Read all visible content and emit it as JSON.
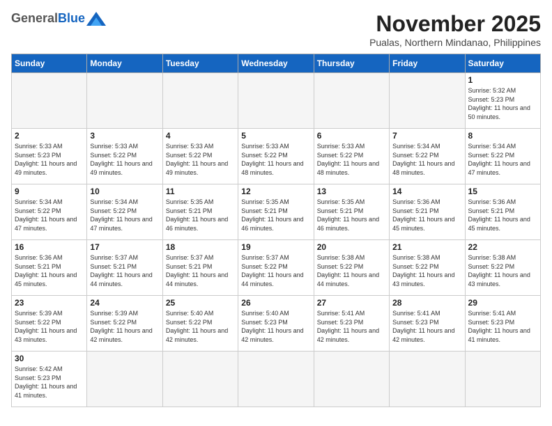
{
  "header": {
    "logo_general": "General",
    "logo_blue": "Blue",
    "month_title": "November 2025",
    "location": "Pualas, Northern Mindanao, Philippines"
  },
  "weekdays": [
    "Sunday",
    "Monday",
    "Tuesday",
    "Wednesday",
    "Thursday",
    "Friday",
    "Saturday"
  ],
  "weeks": [
    [
      {
        "day": "",
        "empty": true
      },
      {
        "day": "",
        "empty": true
      },
      {
        "day": "",
        "empty": true
      },
      {
        "day": "",
        "empty": true
      },
      {
        "day": "",
        "empty": true
      },
      {
        "day": "",
        "empty": true
      },
      {
        "day": "1",
        "sunrise": "5:32 AM",
        "sunset": "5:23 PM",
        "daylight": "11 hours and 50 minutes."
      }
    ],
    [
      {
        "day": "2",
        "sunrise": "5:33 AM",
        "sunset": "5:23 PM",
        "daylight": "11 hours and 49 minutes."
      },
      {
        "day": "3",
        "sunrise": "5:33 AM",
        "sunset": "5:22 PM",
        "daylight": "11 hours and 49 minutes."
      },
      {
        "day": "4",
        "sunrise": "5:33 AM",
        "sunset": "5:22 PM",
        "daylight": "11 hours and 49 minutes."
      },
      {
        "day": "5",
        "sunrise": "5:33 AM",
        "sunset": "5:22 PM",
        "daylight": "11 hours and 48 minutes."
      },
      {
        "day": "6",
        "sunrise": "5:33 AM",
        "sunset": "5:22 PM",
        "daylight": "11 hours and 48 minutes."
      },
      {
        "day": "7",
        "sunrise": "5:34 AM",
        "sunset": "5:22 PM",
        "daylight": "11 hours and 48 minutes."
      },
      {
        "day": "8",
        "sunrise": "5:34 AM",
        "sunset": "5:22 PM",
        "daylight": "11 hours and 47 minutes."
      }
    ],
    [
      {
        "day": "9",
        "sunrise": "5:34 AM",
        "sunset": "5:22 PM",
        "daylight": "11 hours and 47 minutes."
      },
      {
        "day": "10",
        "sunrise": "5:34 AM",
        "sunset": "5:22 PM",
        "daylight": "11 hours and 47 minutes."
      },
      {
        "day": "11",
        "sunrise": "5:35 AM",
        "sunset": "5:21 PM",
        "daylight": "11 hours and 46 minutes."
      },
      {
        "day": "12",
        "sunrise": "5:35 AM",
        "sunset": "5:21 PM",
        "daylight": "11 hours and 46 minutes."
      },
      {
        "day": "13",
        "sunrise": "5:35 AM",
        "sunset": "5:21 PM",
        "daylight": "11 hours and 46 minutes."
      },
      {
        "day": "14",
        "sunrise": "5:36 AM",
        "sunset": "5:21 PM",
        "daylight": "11 hours and 45 minutes."
      },
      {
        "day": "15",
        "sunrise": "5:36 AM",
        "sunset": "5:21 PM",
        "daylight": "11 hours and 45 minutes."
      }
    ],
    [
      {
        "day": "16",
        "sunrise": "5:36 AM",
        "sunset": "5:21 PM",
        "daylight": "11 hours and 45 minutes."
      },
      {
        "day": "17",
        "sunrise": "5:37 AM",
        "sunset": "5:21 PM",
        "daylight": "11 hours and 44 minutes."
      },
      {
        "day": "18",
        "sunrise": "5:37 AM",
        "sunset": "5:21 PM",
        "daylight": "11 hours and 44 minutes."
      },
      {
        "day": "19",
        "sunrise": "5:37 AM",
        "sunset": "5:22 PM",
        "daylight": "11 hours and 44 minutes."
      },
      {
        "day": "20",
        "sunrise": "5:38 AM",
        "sunset": "5:22 PM",
        "daylight": "11 hours and 44 minutes."
      },
      {
        "day": "21",
        "sunrise": "5:38 AM",
        "sunset": "5:22 PM",
        "daylight": "11 hours and 43 minutes."
      },
      {
        "day": "22",
        "sunrise": "5:38 AM",
        "sunset": "5:22 PM",
        "daylight": "11 hours and 43 minutes."
      }
    ],
    [
      {
        "day": "23",
        "sunrise": "5:39 AM",
        "sunset": "5:22 PM",
        "daylight": "11 hours and 43 minutes."
      },
      {
        "day": "24",
        "sunrise": "5:39 AM",
        "sunset": "5:22 PM",
        "daylight": "11 hours and 42 minutes."
      },
      {
        "day": "25",
        "sunrise": "5:40 AM",
        "sunset": "5:22 PM",
        "daylight": "11 hours and 42 minutes."
      },
      {
        "day": "26",
        "sunrise": "5:40 AM",
        "sunset": "5:23 PM",
        "daylight": "11 hours and 42 minutes."
      },
      {
        "day": "27",
        "sunrise": "5:41 AM",
        "sunset": "5:23 PM",
        "daylight": "11 hours and 42 minutes."
      },
      {
        "day": "28",
        "sunrise": "5:41 AM",
        "sunset": "5:23 PM",
        "daylight": "11 hours and 42 minutes."
      },
      {
        "day": "29",
        "sunrise": "5:41 AM",
        "sunset": "5:23 PM",
        "daylight": "11 hours and 41 minutes."
      }
    ],
    [
      {
        "day": "30",
        "sunrise": "5:42 AM",
        "sunset": "5:23 PM",
        "daylight": "11 hours and 41 minutes."
      },
      {
        "day": "",
        "empty": true
      },
      {
        "day": "",
        "empty": true
      },
      {
        "day": "",
        "empty": true
      },
      {
        "day": "",
        "empty": true
      },
      {
        "day": "",
        "empty": true
      },
      {
        "day": "",
        "empty": true
      }
    ]
  ]
}
